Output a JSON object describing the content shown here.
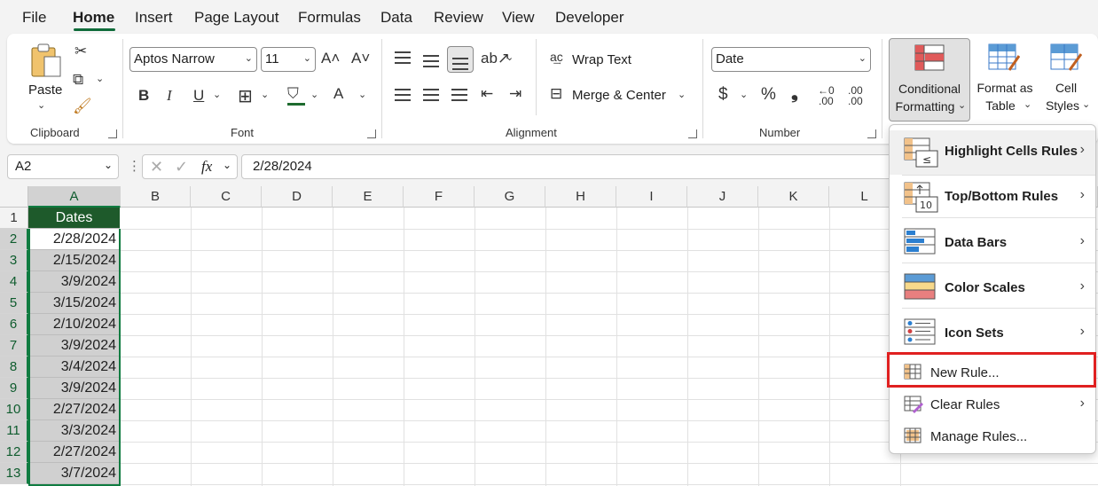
{
  "menu": {
    "tabs": [
      "File",
      "Home",
      "Insert",
      "Page Layout",
      "Formulas",
      "Data",
      "Review",
      "View",
      "Developer"
    ],
    "active_tab": "Home"
  },
  "ribbon": {
    "clipboard": {
      "paste": "Paste",
      "group": "Clipboard"
    },
    "font": {
      "name": "Aptos Narrow",
      "size": "11",
      "group": "Font",
      "bold": "B",
      "italic": "I",
      "underline": "U"
    },
    "alignment": {
      "wrap_text": "Wrap Text",
      "merge_center": "Merge & Center",
      "group": "Alignment"
    },
    "number": {
      "format": "Date",
      "currency": "$",
      "percent": "%",
      "comma": "❟",
      "inc_decimal": ".00",
      "dec_decimal": ".00",
      "group": "Number"
    },
    "styles": {
      "cond_line1": "Conditional",
      "cond_line2": "Formatting",
      "fat_line1": "Format as",
      "fat_line2": "Table",
      "cs_line1": "Cell",
      "cs_line2": "Styles"
    }
  },
  "formula_bar": {
    "name_box": "A2",
    "fx": "fx",
    "formula": "2/28/2024"
  },
  "columns": [
    "A",
    "B",
    "C",
    "D",
    "E",
    "F",
    "G",
    "H",
    "I",
    "J",
    "K",
    "L"
  ],
  "rows": [
    "1",
    "2",
    "3",
    "4",
    "5",
    "6",
    "7",
    "8",
    "9",
    "10",
    "11",
    "12",
    "13"
  ],
  "cells": {
    "header": "Dates",
    "dates": [
      "2/28/2024",
      "2/15/2024",
      "3/9/2024",
      "3/15/2024",
      "2/10/2024",
      "3/9/2024",
      "3/4/2024",
      "3/9/2024",
      "2/27/2024",
      "3/3/2024",
      "2/27/2024",
      "3/7/2024"
    ]
  },
  "dropdown": {
    "items": [
      {
        "label": "Highlight Cells Rules",
        "bold": true,
        "submenu": true
      },
      {
        "label": "Top/Bottom Rules",
        "bold": true,
        "submenu": true
      },
      {
        "label": "Data Bars",
        "bold": true,
        "submenu": true
      },
      {
        "label": "Color Scales",
        "bold": true,
        "submenu": true
      },
      {
        "label": "Icon Sets",
        "bold": true,
        "submenu": true
      },
      {
        "label": "New Rule...",
        "bold": false,
        "submenu": false
      },
      {
        "label": "Clear Rules",
        "bold": false,
        "submenu": true
      },
      {
        "label": "Manage Rules...",
        "bold": false,
        "submenu": false
      }
    ],
    "topbottom_icon_text": "10"
  },
  "colors": {
    "accent": "#107c41",
    "header_fill": "#1e5a2b",
    "highlight_box": "#e02020"
  }
}
